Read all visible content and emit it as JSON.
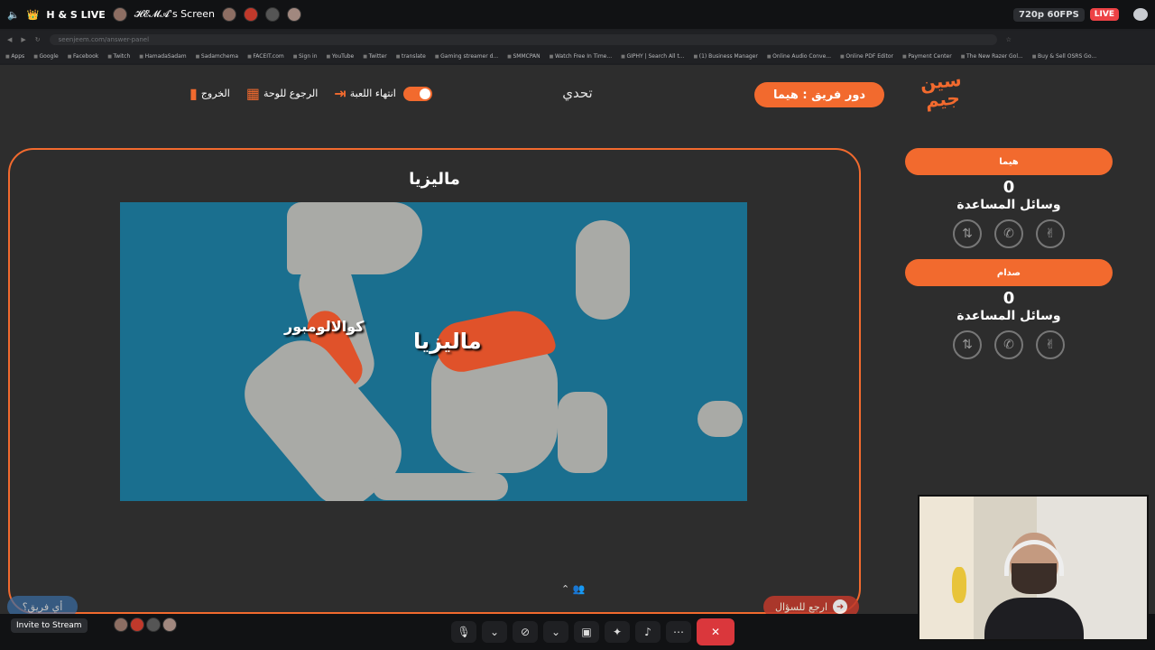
{
  "stream": {
    "title": "H & S LIVE",
    "screen_owner": "𝓗𝓔𝓜𝓐's Screen",
    "resolution": "720p 60FPS",
    "live_label": "LIVE",
    "invite_label": "Invite to Stream"
  },
  "browser": {
    "url": "seenjeem.com/answer-panel",
    "bookmarks": [
      "Apps",
      "Google",
      "Facebook",
      "Twitch",
      "HamadaSadam",
      "Sadamchema",
      "FACEIT.com",
      "Sign in",
      "YouTube",
      "Twitter",
      "translate",
      "Gaming streamer d...",
      "SMMCPAN",
      "Watch Free In Time...",
      "GIPHY | Search All t...",
      "(1) Business Manager",
      "Online Audio Conve...",
      "Online PDF Editor",
      "Payment Center",
      "The New Razer Gol...",
      "Buy & Sell OSRS Go..."
    ]
  },
  "header": {
    "logo_text": "سين جيم",
    "team_turn": "دور فريق : هيما",
    "mode": "تحدي",
    "end_game": "انتهاء اللعبة",
    "back_to_board": "الرجوع للوحة",
    "exit": "الخروج"
  },
  "question": {
    "title": "ماليزيا",
    "map_labels": {
      "country": "ماليزيا",
      "capital": "كوالالومبور"
    }
  },
  "teams": [
    {
      "name": "هيما",
      "score": "0",
      "aids_label": "وسائل المساعدة"
    },
    {
      "name": "صدام",
      "score": "0",
      "aids_label": "وسائل المساعدة"
    }
  ],
  "icons": {
    "aid_swap": "swap-icon",
    "aid_call": "phone-icon",
    "aid_two": "two-fingers-icon"
  },
  "buttons": {
    "back_to_question": "ارجع للسؤال",
    "which_team": "أي فريق؟"
  },
  "colors": {
    "accent": "#f26a2e",
    "background": "#2d2d2d",
    "end_call": "#da373c"
  }
}
